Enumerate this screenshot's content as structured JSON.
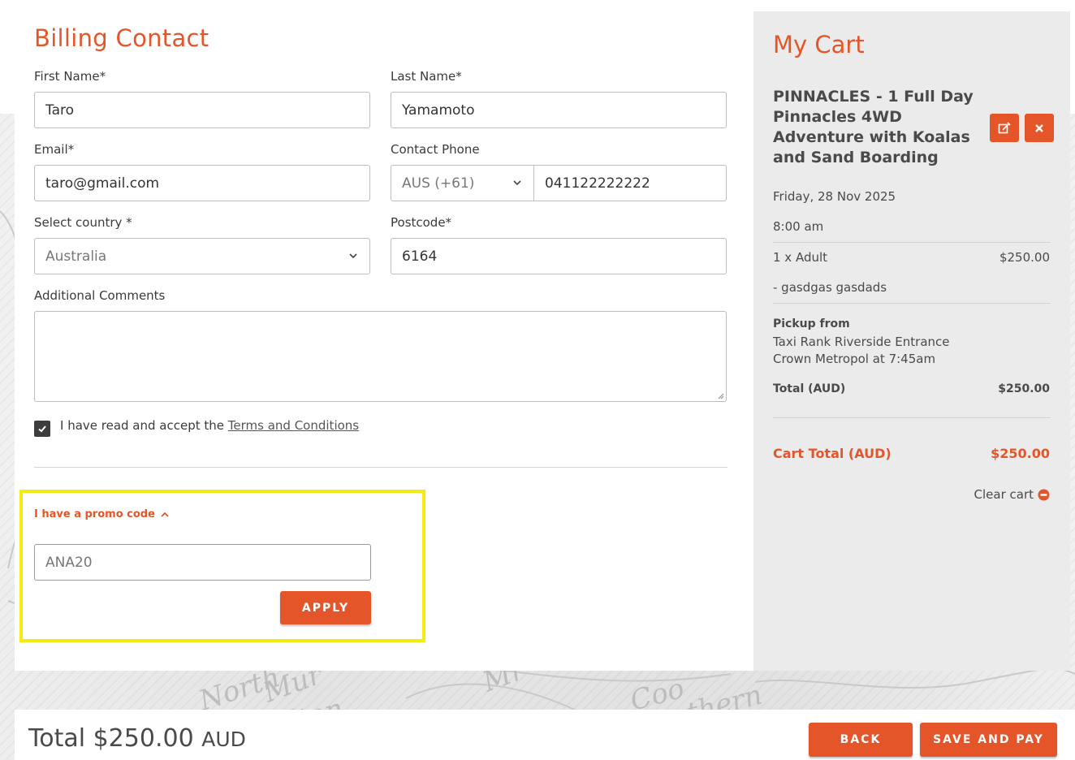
{
  "billing": {
    "title": "Billing Contact",
    "first_name_label": "First Name*",
    "first_name_value": "Taro",
    "last_name_label": "Last Name*",
    "last_name_value": "Yamamoto",
    "email_label": "Email*",
    "email_value": "taro@gmail.com",
    "phone_label": "Contact Phone",
    "phone_country_code": "AUS (+61)",
    "phone_value": "041122222222",
    "country_label": "Select country *",
    "country_value": "Australia",
    "postcode_label": "Postcode*",
    "postcode_value": "6164",
    "comments_label": "Additional Comments",
    "comments_value": "",
    "terms_text": "I have read and accept the ",
    "terms_link": "Terms and Conditions",
    "terms_checked": true
  },
  "promo": {
    "toggle_label": "I have a promo code",
    "code_value": "ANA20",
    "apply_label": "APPLY",
    "highlight_color": "#f4ea14"
  },
  "cart": {
    "title": "My Cart",
    "item_title": "PINNACLES - 1 Full Day Pinnacles 4WD Adventure with Koalas and Sand Boarding",
    "date": "Friday, 28 Nov 2025",
    "time": "8:00 am",
    "line_item_label": "1 x Adult",
    "line_item_price": "$250.00",
    "traveller": "- gasdgas gasdads",
    "pickup_heading": "Pickup from",
    "pickup_line1": "Taxi Rank Riverside Entrance",
    "pickup_line2": "Crown Metropol at 7:45am",
    "item_total_label": "Total (AUD)",
    "item_total_value": "$250.00",
    "cart_total_label": "Cart Total (AUD)",
    "cart_total_value": "$250.00",
    "clear_label": "Clear cart"
  },
  "footer": {
    "total_prefix": "Total $250.00",
    "currency": "AUD",
    "back_label": "BACK",
    "pay_label": "SAVE AND PAY"
  },
  "colors": {
    "accent": "#e4562a",
    "panel": "#ebebeb",
    "checkbox": "#3d3d3d"
  },
  "icons": [
    "chevron-down-icon",
    "check-icon",
    "chevron-up-icon",
    "edit-icon",
    "close-icon",
    "minus-circle-icon"
  ]
}
